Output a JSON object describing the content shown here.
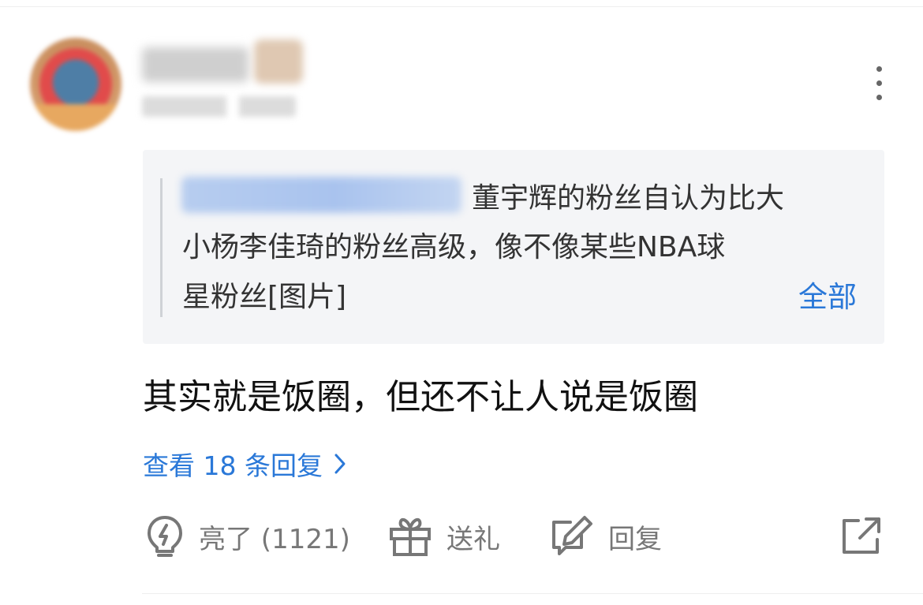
{
  "comment": {
    "quote": {
      "line1": "董宇辉的粉丝自认为比大",
      "line2": "小杨李佳琦的粉丝高级，像不像某些NBA球",
      "line3": "星粉丝[图片]",
      "expand_label": "全部"
    },
    "text": "其实就是饭圈，但还不让人说是饭圈",
    "view_replies_label": "查看 18 条回复"
  },
  "actions": {
    "like_label": "亮了 (1121)",
    "gift_label": "送礼",
    "reply_label": "回复"
  },
  "icons": {
    "like": "lightbulb-icon",
    "gift": "gift-icon",
    "reply": "edit-reply-icon",
    "share": "share-icon",
    "more": "more-vertical-icon",
    "chevron": "chevron-right-icon"
  },
  "colors": {
    "link": "#2a78d8",
    "text": "#111111",
    "quote_text": "#333333",
    "muted": "#777777",
    "quote_background": "#f4f5f7"
  }
}
